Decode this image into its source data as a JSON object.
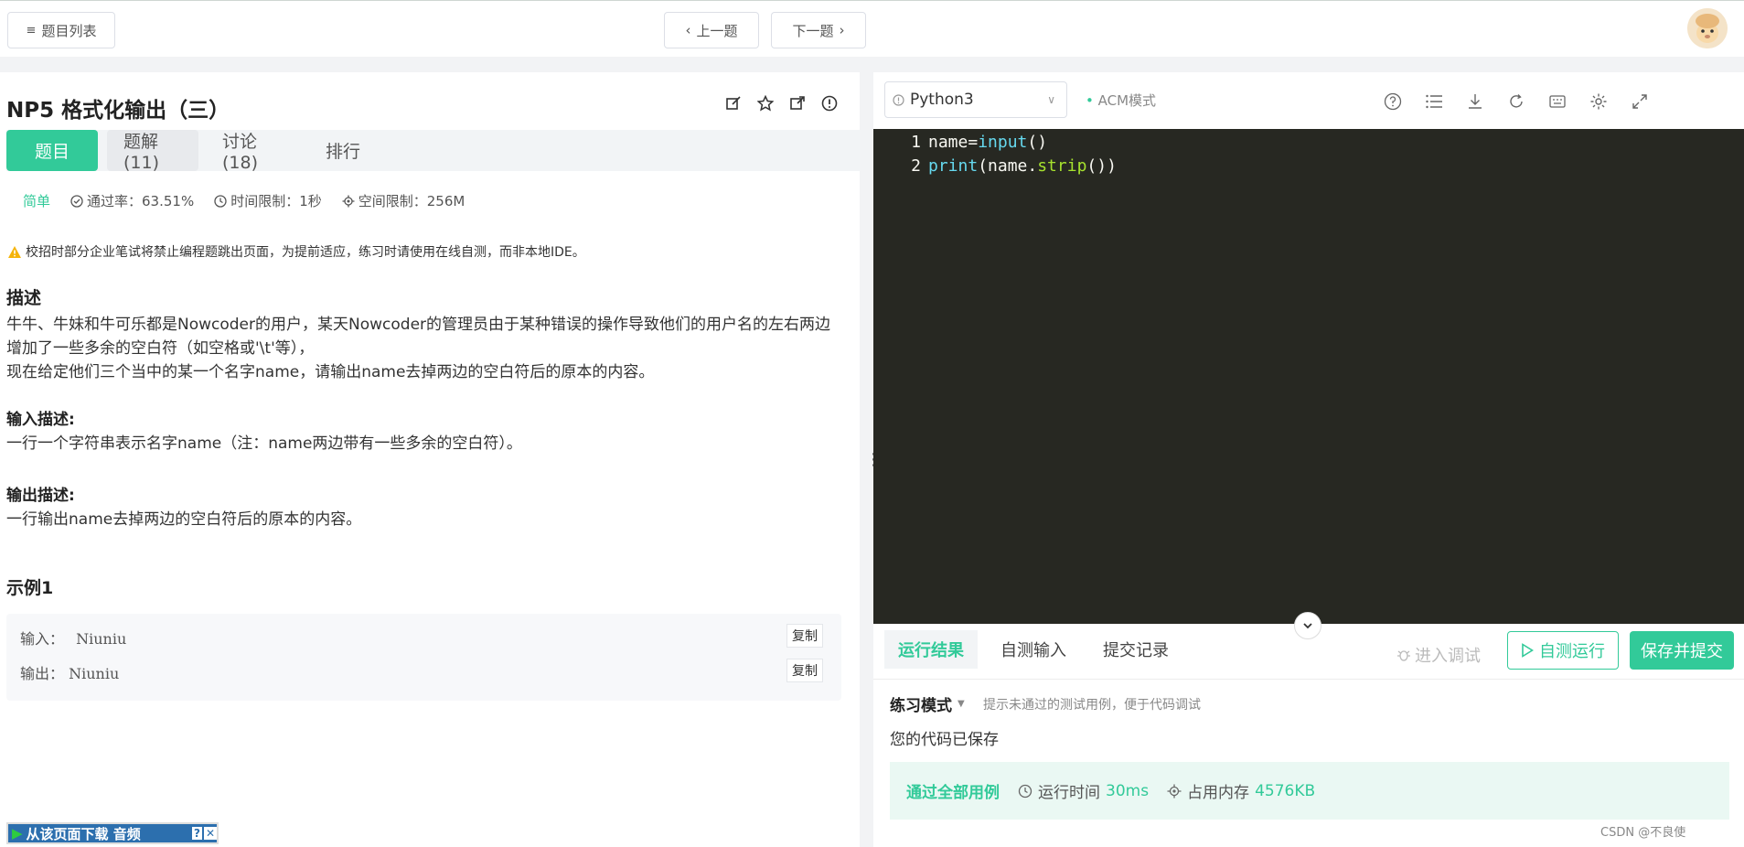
{
  "topbar": {
    "list_label": "题目列表",
    "prev_label": "上一题",
    "next_label": "下一题"
  },
  "problem": {
    "title": "NP5  格式化输出（三）",
    "tabs": [
      {
        "label": "题目"
      },
      {
        "label": "题解(11)"
      },
      {
        "label": "讨论(18)"
      },
      {
        "label": "排行"
      }
    ],
    "difficulty": "简单",
    "pass_rate": "通过率：63.51%",
    "time_limit": "时间限制：1秒",
    "space_limit": "空间限制：256M",
    "warning": "校招时部分企业笔试将禁止编程题跳出页面，为提前适应，练习时请使用在线自测，而非本地IDE。",
    "desc_heading": "描述",
    "desc_line1": "牛牛、牛妹和牛可乐都是Nowcoder的用户，某天Nowcoder的管理员由于某种错误的操作导致他们的用户名的左右两边",
    "desc_line2": "增加了一些多余的空白符（如空格或'\\t'等），",
    "desc_line3": "现在给定他们三个当中的某一个名字name，请输出name去掉两边的空白符后的原本的内容。",
    "input_heading": "输入描述:",
    "input_text": "一行一个字符串表示名字name（注：name两边带有一些多余的空白符）。",
    "output_heading": "输出描述:",
    "output_text": "一行输出name去掉两边的空白符后的原本的内容。",
    "example_heading": "示例1",
    "example_input_label": "输入：",
    "example_input_value": "Niuniu",
    "example_output_label": "输出：",
    "example_output_value": "Niuniu",
    "copy_label": "复制",
    "download_bar": "从该页面下载 音频"
  },
  "editor": {
    "language": "Python3",
    "mode": "ACM模式",
    "code_lines": [
      {
        "num": "1",
        "segments": [
          {
            "t": "name=",
            "c": "plain"
          },
          {
            "t": "input",
            "c": "kw"
          },
          {
            "t": "()",
            "c": "plain"
          }
        ]
      },
      {
        "num": "2",
        "segments": [
          {
            "t": "print",
            "c": "kw"
          },
          {
            "t": "(name.",
            "c": "plain"
          },
          {
            "t": "strip",
            "c": "fn"
          },
          {
            "t": "())",
            "c": "plain"
          }
        ]
      }
    ]
  },
  "result": {
    "tabs": [
      {
        "label": "运行结果"
      },
      {
        "label": "自测输入"
      },
      {
        "label": "提交记录"
      }
    ],
    "debug_label": "进入调试",
    "run_label": "自测运行",
    "submit_label": "保存并提交",
    "mode_label": "练习模式",
    "mode_tip": "提示未通过的测试用例，便于代码调试",
    "saved_text": "您的代码已保存",
    "pass_text": "通过全部用例",
    "runtime_label": "运行时间",
    "runtime_value": "30ms",
    "memory_label": "占用内存",
    "memory_value": "4576KB",
    "watermark": "CSDN @不良使"
  },
  "colors": {
    "accent": "#32ca99",
    "editor_bg": "#272822"
  }
}
